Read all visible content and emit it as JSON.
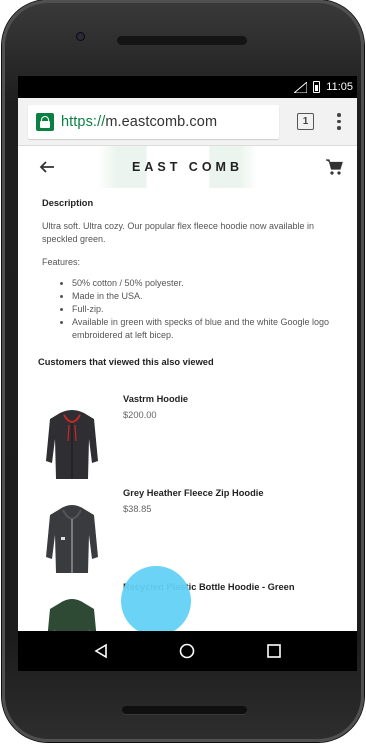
{
  "status_bar": {
    "time": "11:05"
  },
  "browser": {
    "url_scheme": "https://",
    "url_host": "m.eastcomb.com",
    "tab_count": "1"
  },
  "app_bar": {
    "brand": "EAST COMB"
  },
  "description": {
    "title": "Description",
    "body": "Ultra soft. Ultra cozy. Our popular flex fleece hoodie now available in speckled green.",
    "features_label": "Features:",
    "features": [
      "50% cotton / 50% polyester.",
      "Made in the USA.",
      "Full-zip.",
      "Available in green with specks of blue and the white Google logo embroidered at left bicep."
    ]
  },
  "related": {
    "title": "Customers that viewed this also viewed",
    "items": [
      {
        "name": "Vastrm Hoodie",
        "price": "$200.00"
      },
      {
        "name": "Grey Heather Fleece Zip Hoodie",
        "price": "$38.85"
      },
      {
        "name": "Recycled Plastic Bottle Hoodie - Green",
        "price": ""
      }
    ]
  },
  "colors": {
    "secure_green": "#0b8043",
    "touch_indicator": "#63d1f4"
  }
}
